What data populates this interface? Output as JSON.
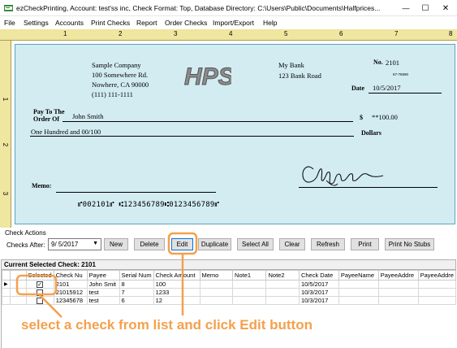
{
  "window": {
    "title": "ezCheckPrinting, Account: test'ss inc, Check Format: Top, Database Directory: C:\\Users\\Public\\Documents\\Halfprices...",
    "minimize": "—",
    "maximize": "☐",
    "close": "✕"
  },
  "menu": [
    "File",
    "Settings",
    "Accounts",
    "Print Checks",
    "Report",
    "Order Checks",
    "Import/Export",
    "Help"
  ],
  "ruler": {
    "top": [
      "1",
      "2",
      "3",
      "4",
      "5",
      "6",
      "7",
      "8"
    ],
    "left": [
      "1",
      "2",
      "3"
    ]
  },
  "check": {
    "company_name": "Sample Company",
    "company_addr1": "100 Somewhere Rd.",
    "company_addr2": "Nowhere, CA 90000",
    "company_phone": "(111) 111-1111",
    "logo": "HPS",
    "bank_name": "My Bank",
    "bank_addr": "123 Bank Road",
    "no_label": "No.",
    "check_number": "2101",
    "fraction": "67-76590",
    "date_label": "Date",
    "date": "10/5/2017",
    "pay_to_label": "Pay To The",
    "order_of_label": "Order Of",
    "payee": "John Smith",
    "dollar_sign": "$",
    "amount": "**100.00",
    "amount_words": "One Hundred  and 00/100",
    "dollars_label": "Dollars",
    "memo_label": "Memo:",
    "micr": "⑈002101⑈ ⑆123456789⑆0123456789⑈"
  },
  "actions": {
    "group_label": "Check Actions",
    "checks_after_label": "Checks After:",
    "checks_after_value": "9/ 5/2017",
    "buttons": {
      "new": "New",
      "delete": "Delete",
      "edit": "Edit",
      "duplicate": "Duplicate",
      "select_all": "Select All",
      "clear": "Clear",
      "refresh": "Refresh",
      "print": "Print",
      "print_no_stubs": "Print No Stubs"
    }
  },
  "grid": {
    "caption": "Current Selected Check: 2101",
    "columns": [
      "Selected",
      "Check Nu",
      "Payee",
      "Serial Num",
      "Check Amount",
      "Memo",
      "Note1",
      "Note2",
      "Check Date",
      "PayeeName",
      "PayeeAddre",
      "PayeeAddre"
    ],
    "rows": [
      {
        "selected": true,
        "check_no": "2101",
        "payee": "John Smit",
        "serial": "8",
        "amount": "100",
        "memo": "",
        "note1": "",
        "note2": "",
        "date": "10/5/2017",
        "payee_name": "",
        "addr1": "",
        "addr2": ""
      },
      {
        "selected": false,
        "check_no": "21015912",
        "payee": "test",
        "serial": "7",
        "amount": "1233",
        "memo": "",
        "note1": "",
        "note2": "",
        "date": "10/3/2017",
        "payee_name": "",
        "addr1": "",
        "addr2": ""
      },
      {
        "selected": false,
        "check_no": "12345678",
        "payee": "test",
        "serial": "6",
        "amount": "12",
        "memo": "",
        "note1": "",
        "note2": "",
        "date": "10/3/2017",
        "payee_name": "",
        "addr1": "",
        "addr2": ""
      }
    ]
  },
  "annotation": {
    "text": "select a check from list and click Edit button",
    "color": "#f4a04c"
  },
  "colors": {
    "check_bg": "#d2ecf2",
    "ruler_bg": "#efe6a0",
    "highlight": "#f4a04c"
  }
}
